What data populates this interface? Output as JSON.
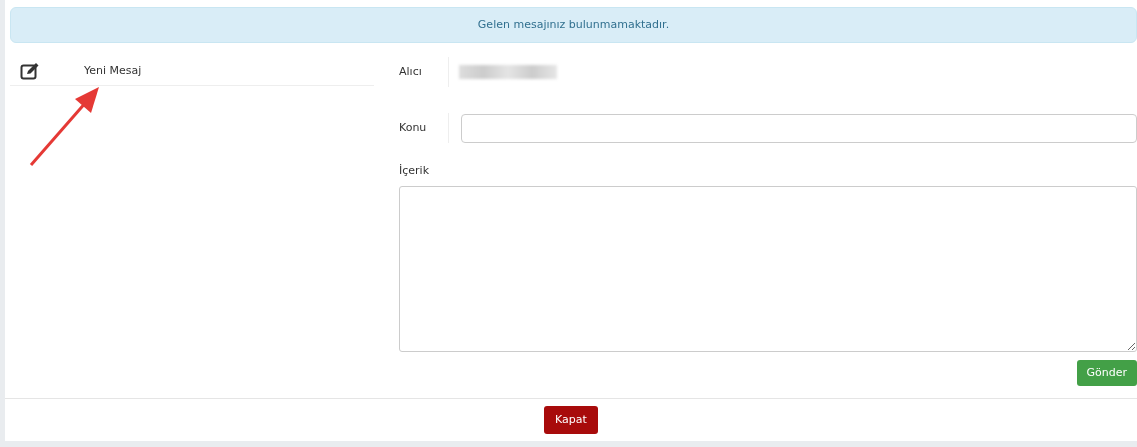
{
  "alert": {
    "text": "Gelen mesajınız bulunmamaktadır."
  },
  "sidebar": {
    "items": [
      {
        "label": "Yeni Mesaj"
      }
    ]
  },
  "form": {
    "recipient_label": "Alıcı",
    "subject_label": "Konu",
    "content_label": "İçerik",
    "send_button": "Gönder"
  },
  "footer": {
    "close_button": "Kapat"
  }
}
